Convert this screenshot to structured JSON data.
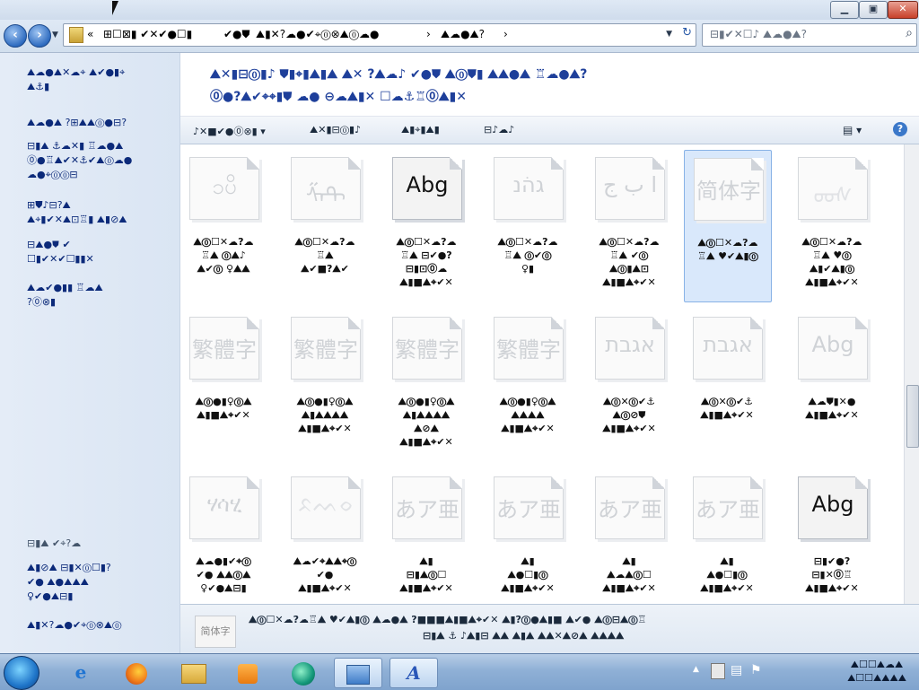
{
  "window": {
    "controls": {
      "minimize": "▁",
      "maximize": "▣",
      "close": "✕"
    }
  },
  "address": {
    "back_icon": "back-arrow-icon",
    "forward_icon": "forward-arrow-icon",
    "breadcrumb": [
      "«",
      "⊞☐⊠▮ ✔✕✔●☐▮",
      "✔●⛊",
      "⛰▮✕?☁●✔⌖⓪⊗⛰⓪☁●",
      "›",
      "⛰☁●⛰?",
      "›"
    ],
    "search_placeholder": "⊟▮✔✕☐♪ ⛰☁●⛰?"
  },
  "sidebar": {
    "links": [
      "⛰☁●⛰✕☁⌖  ⛰✔●▮⌖\n⛰⚓▮",
      "⛰☁●⛰ ?⊞⛰⛰⓪●⊟?",
      "⊟▮⛰ ⚓☁✕▮  ♖☁●⛰\n⓪●♖⛰✔✕⚓✔⛰⓪☁●\n☁●⌖⓪⓪⊟",
      "⊞⛊♪⊟?⛰\n⛰⌖▮✔✕⛰⊡♖▮ ⛰▮⊘⛰",
      "⊟⛰●⛊ ✔\n☐▮✔✕✔☐▮▮✕",
      "⛰☁✔●▮▮ ♖☁⛰\n?⓪⊗▮"
    ],
    "see_also": "⊟▮⛰ ✔⌖?☁",
    "bottom_links": [
      "⛰▮⊘⛰ ⊟▮✕⓪☐▮?\n✔● ⛰●⛰⛰⛰\n♀✔●⛰⊟▮",
      "⛰▮✕?☁●✔⌖⓪⊗⛰⓪"
    ]
  },
  "header": {
    "line1": "⛰✕▮⊟⓪▮♪ ⛊▮⌖▮⛰▮⛰ ⛰✕ ?⛰☁♪ ✔●⛊ ⛰⓪⛊▮ ⛰⛰●⛰ ♖☁●⛰?",
    "line2": "⓪●?⛰✔⌖⌖▮⛊ ☁● ⊖☁⛰▮✕ ☐☁⚓♖⓪⛰▮✕"
  },
  "toolbar": {
    "organize": "♪✕■✔●⓪⊗▮",
    "preview": "⛰✕▮⊟⓪▮♪",
    "delete": "⛰▮⌖▮⛰▮",
    "show": "⊟♪☁♪",
    "view_icon": "view-options-icon",
    "help_icon": "help-icon"
  },
  "fonts": [
    {
      "glyph": "ၥပိ",
      "style": "faint",
      "caption": "⛰⓪☐✕☁?☁\n♖⛰ ⓪⛰♪\n⛰✔⓪ ♀⛰⛰"
    },
    {
      "glyph": "ᠱᠨᠲ",
      "style": "faint",
      "caption": "⛰⓪☐✕☁?☁\n♖⛰\n⛰✔■?⛰✔"
    },
    {
      "glyph": "Abg",
      "style": "strong",
      "caption": "⛰⓪☐✕☁?☁\n♖⛰ ⊟✔●?\n⊟▮⊡⓪☁\n⛰▮■⛰⌖✔✕"
    },
    {
      "glyph": "ׁגהנ",
      "style": "faint",
      "caption": "⛰⓪☐✕☁?☁\n♖⛰ ⓪✔⓪\n♀▮"
    },
    {
      "glyph": "ا ب ج",
      "style": "faint",
      "caption": "⛰⓪☐✕☁?☁\n♖⛰ ✔⓪\n⛰⓪▮⛰⊡\n⛰▮■⛰⌖✔✕"
    },
    {
      "glyph": "简体字",
      "style": "faint",
      "caption": "⛰⓪☐✕☁?☁\n♖⛰ ♥✔⛰▮⓪"
    },
    {
      "glyph": "ᡂᠰ",
      "style": "dim",
      "caption": "⛰⓪☐✕☁?☁\n♖⛰ ♥⓪\n⛰▮✔⛰▮⓪\n⛰▮■⛰⌖✔✕"
    },
    {
      "glyph": "繁體字",
      "style": "faint",
      "caption": "⛰⓪●▮♀⓪⛰\n⛰▮■⛰⌖✔✕"
    },
    {
      "glyph": "繁體字",
      "style": "faint",
      "caption": "⛰⓪●▮♀⓪⛰\n⛰▮⛰⛰⛰⛰\n⛰▮■⛰⌖✔✕"
    },
    {
      "glyph": "繁體字",
      "style": "faint",
      "caption": "⛰⓪●▮♀⓪⛰\n⛰▮⛰⛰⛰⛰\n⛰⊘⛰\n⛰▮■⛰⌖✔✕"
    },
    {
      "glyph": "繁體字",
      "style": "faint",
      "caption": "⛰⓪●▮♀⓪⛰\n⛰⛰⛰⛰\n⛰▮■⛰⌖✔✕"
    },
    {
      "glyph": "אגבת",
      "style": "faint",
      "caption": "⛰⓪✕⓪✔⚓\n⛰⓪⊘⛊\n⛰▮■⛰⌖✔✕"
    },
    {
      "glyph": "אגבת",
      "style": "faint",
      "caption": "⛰⓪✕⓪✔⚓\n⛰▮■⛰⌖✔✕"
    },
    {
      "glyph": "Abg",
      "style": "faint",
      "caption": "⛰☁⛊▮✕●\n⛰▮■⛰⌖✔✕"
    },
    {
      "glyph": "ሃሳሂ",
      "style": "faint",
      "caption": "⛰☁●▮✔⌖⓪\n✔● ⛰⛰⓪⛰\n♀✔●⛰⊟▮"
    },
    {
      "glyph": "ᨅᨓᨔ",
      "style": "dim",
      "caption": "⛰☁✔⌖⛰⛰⌖⓪\n✔●\n⛰▮■⛰⌖✔✕"
    },
    {
      "glyph": "あア亜",
      "style": "faint",
      "caption": "⛰▮\n⊟▮⛰⓪☐\n⛰▮■⛰⌖✔✕"
    },
    {
      "glyph": "あア亜",
      "style": "faint",
      "caption": "⛰▮\n⛰●☐▮⓪\n⛰▮■⛰⌖✔✕"
    },
    {
      "glyph": "あア亜",
      "style": "faint",
      "caption": "⛰▮\n⛰☁⛰⓪☐\n⛰▮■⛰⌖✔✕"
    },
    {
      "glyph": "あア亜",
      "style": "faint",
      "caption": "⛰▮\n⛰●☐▮⓪\n⛰▮■⛰⌖✔✕"
    },
    {
      "glyph": "Abg",
      "style": "strong",
      "caption": "⊟▮✔●?\n⊟▮✕⓪♖\n⛰▮■⛰⌖✔✕"
    }
  ],
  "details": {
    "thumb_text": "简体字",
    "line1": "⛰⓪☐✕☁?☁♖⛰ ♥✔⛰▮⓪  ⛰☁●⛰ ?■■■⛰▮■⛰⌖✔✕  ⛰▮?⓪●⛰▮■  ⛰✔●  ⛰⓪⊟⛰⓪♖",
    "line2": "⊟▮⛰ ⚓ ♪⛰▮⊟ ⛰⛰ ⛰▮⛰  ⛰⛰✕⛰⊘⛰  ⛰⛰⛰⛰"
  },
  "taskbar": {
    "apps": [
      "ie-icon",
      "firefox-icon",
      "explorer-icon",
      "media-player-icon",
      "browser-icon",
      "control-panel-icon",
      "fonts-icon"
    ],
    "clock_time": "⛰☐☐⛰☁⛰",
    "clock_date": "⛰☐☐⛰⛰⛰⛰"
  }
}
